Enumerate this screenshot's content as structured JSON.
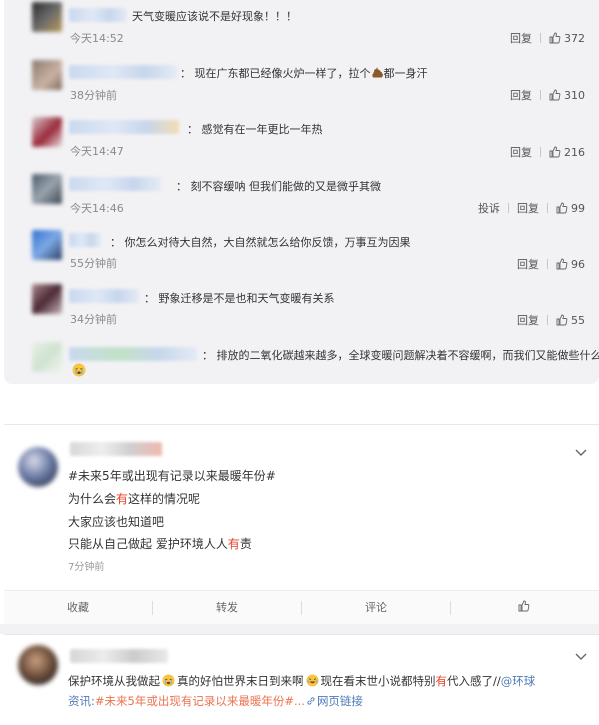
{
  "comments": [
    {
      "text": "天气变暖应该说不是好现象！！！",
      "time": "今天14:52",
      "reply": "回复",
      "likes": "372",
      "report": ""
    },
    {
      "text_before": "： 现在广东都已经像火炉一样了，拉个",
      "text_after": "都一身汗",
      "time": "38分钟前",
      "reply": "回复",
      "likes": "310"
    },
    {
      "text": "： 感觉有在一年更比一年热",
      "time": "今天14:47",
      "reply": "回复",
      "likes": "216"
    },
    {
      "text": "： 刻不容缓呐 但我们能做的又是微乎其微",
      "time": "今天14:46",
      "report": "投诉",
      "reply": "回复",
      "likes": "99"
    },
    {
      "text": "： 你怎么对待大自然，大自然就怎么给你反馈，万事互为因果",
      "time": "55分钟前",
      "reply": "回复",
      "likes": "96"
    },
    {
      "text": "： 野象迁移是不是也和天气变暖有关系",
      "time": "34分钟前",
      "reply": "回复",
      "likes": "55"
    },
    {
      "text": "： 排放的二氧化碳越来越多，全球变暖问题解决着不容缓啊，而我们又能做些什么"
    }
  ],
  "post1": {
    "hashtag": "#未来5年或出现有记录以来最暖年份#",
    "line1_a": "为什么会",
    "line1_red": "有",
    "line1_b": "这样的情况呢",
    "line2": "大家应该也知道吧",
    "line3_a": "只能从自己做起 爱护环境人人",
    "line3_red": "有",
    "line3_b": "责",
    "time": "7分钟前"
  },
  "post_actions": {
    "favorite": "收藏",
    "repost": "转发",
    "comment": "评论"
  },
  "post2": {
    "line1_a": "保护环境从我做起",
    "line1_b": "真的好怕世界末日到来啊",
    "line1_c": "现在看末世小说都特别",
    "line1_red": "有",
    "line1_d": "代入感了//",
    "mention": "@环球",
    "line2_mention": "资讯",
    "line2_colon": ":",
    "line2_hashtag": "#未来5年或出现有记录以来最暖年份#...",
    "weblink": "网页链接"
  },
  "colors": {
    "hashtag": "#eb7350",
    "link": "#4e7bb8",
    "red": "#e8412c",
    "panel": "#f2f2f5"
  }
}
